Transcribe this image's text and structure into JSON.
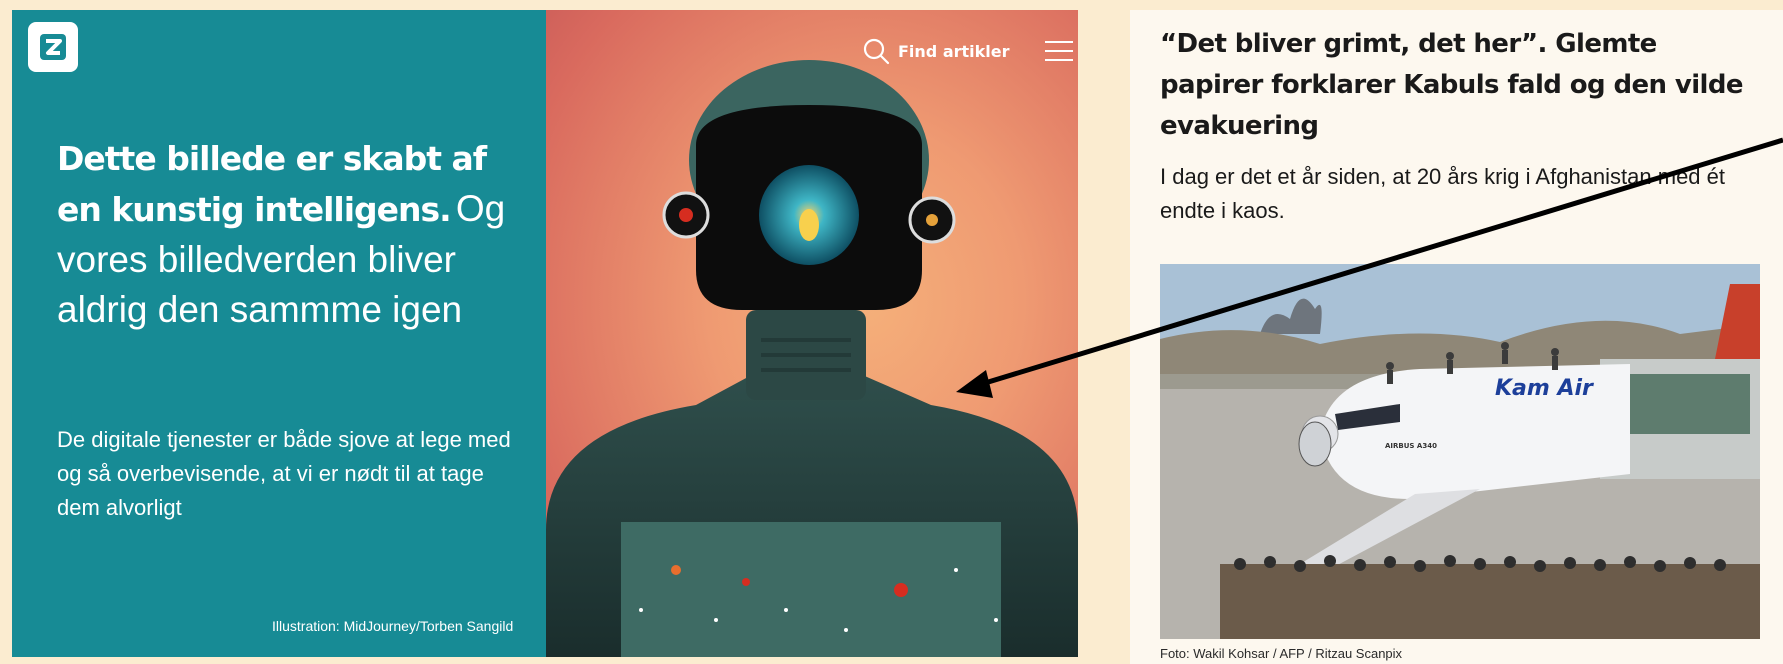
{
  "left_article": {
    "headline_bold": "Dette billede er skabt af en kunstig intelligens.",
    "headline_light": "Og vores billedverden bliver aldrig den sammme igen",
    "teaser": "De digitale tjenester er både sjove at lege med og så overbevisende, at vi er nødt til at tage dem alvorligt",
    "credit": "Illustration: MidJourney/Torben Sangild"
  },
  "header": {
    "search_label": "Find artikler",
    "icons": [
      "logo-icon",
      "search-icon",
      "menu-icon"
    ]
  },
  "right_article": {
    "headline": "“Det bliver grimt, det her”. Glemte papirer forklarer Kabuls fald og den vilde evakuering",
    "teaser": "I dag er det et år siden, at 20 års krig i Afghanistan med ét endte i kaos.",
    "photo_credit": "Foto: Wakil Kohsar / AFP / Ritzau Scanpix",
    "photo_text": {
      "airline": "Kam Air",
      "model": "AIRBUS A340"
    }
  },
  "colors": {
    "page_bg": "#fbecd0",
    "teal": "#178b95",
    "right_card_bg": "#fdf8ef",
    "text_dark": "#1a1a1a"
  }
}
